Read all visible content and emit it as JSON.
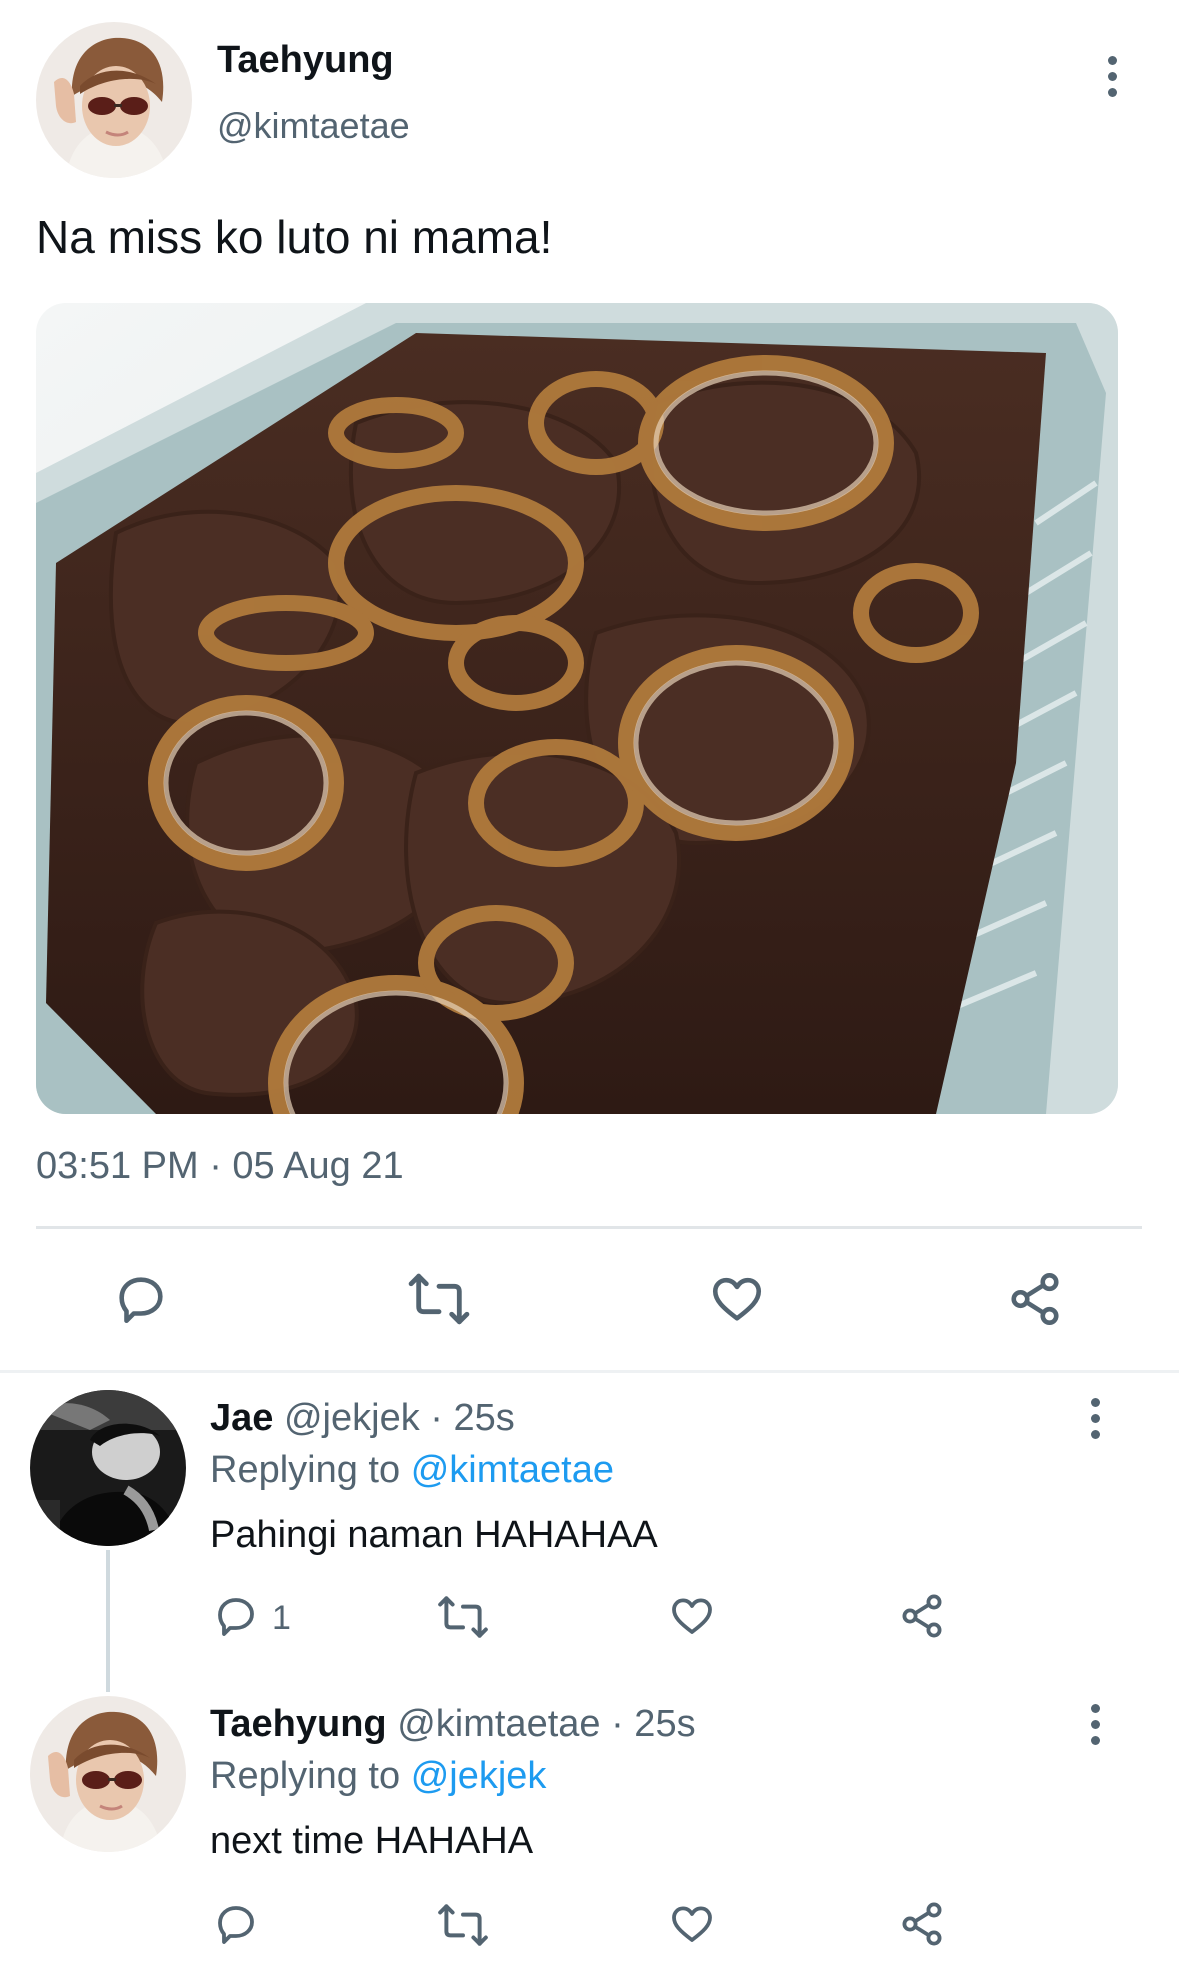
{
  "main_tweet": {
    "author_name": "Taehyung",
    "handle": "@kimtaetae",
    "text": "Na miss ko luto ni mama!",
    "timestamp": "03:51 PM · 05 Aug 21",
    "media_icon": "food-photo",
    "actions": [
      "reply-icon",
      "retweet-icon",
      "like-icon",
      "share-icon"
    ]
  },
  "replies": [
    {
      "author_name": "Jae",
      "handle": "@jekjek",
      "meta": "· 25s",
      "replying_prefix": "Replying to",
      "replying_handle": "@kimtaetae",
      "text": "Pahingi naman HAHAHAA",
      "reply_count": "1"
    },
    {
      "author_name": "Taehyung",
      "handle": "@kimtaetae",
      "meta": "· 25s",
      "replying_prefix": "Replying to",
      "replying_handle": "@jekjek",
      "text": "next time HAHAHA",
      "reply_count": ""
    }
  ],
  "colors": {
    "text": "#0f1419",
    "muted": "#536471",
    "accent": "#1d9bf0",
    "divider": "#e1e5e8"
  }
}
